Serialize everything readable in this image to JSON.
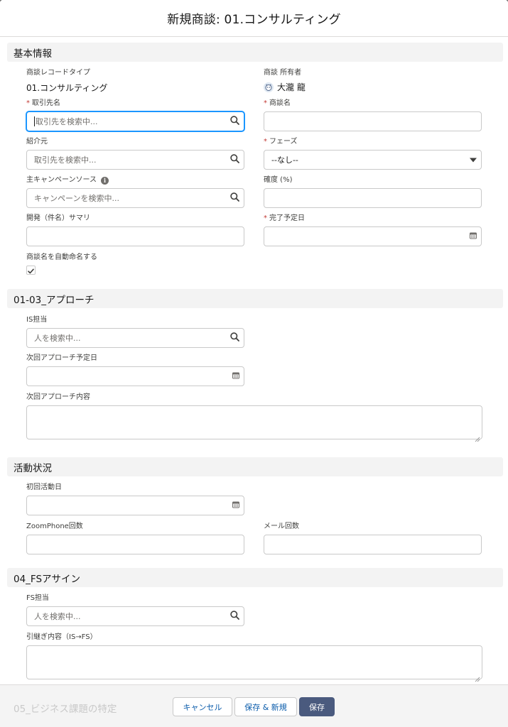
{
  "modal": {
    "title": "新規商談: 01.コンサルティング"
  },
  "sections": {
    "basic": "基本情報",
    "approach": "01-03_アプローチ",
    "activity": "活動状況",
    "fs": "04_FSアサイン",
    "business": "05_ビジネス課題の特定"
  },
  "fields": {
    "record_type": {
      "label": "商談レコードタイプ",
      "value": "01.コンサルティング"
    },
    "owner": {
      "label": "商談 所有者",
      "value": "大瀧 龍"
    },
    "account": {
      "label": "取引先名",
      "placeholder": "取引先を検索中..."
    },
    "opp_name": {
      "label": "商談名",
      "value": ""
    },
    "referrer": {
      "label": "紹介元",
      "placeholder": "取引先を検索中..."
    },
    "phase": {
      "label": "フェーズ",
      "value": "--なし--"
    },
    "campaign": {
      "label": "主キャンペーンソース",
      "placeholder": "キャンペーンを検索中..."
    },
    "probability": {
      "label": "確度 (%)",
      "value": ""
    },
    "summary": {
      "label": "開発（件名）サマリ",
      "value": ""
    },
    "close_date": {
      "label": "完了予定日",
      "value": ""
    },
    "auto_name": {
      "label": "商談名を自動命名する",
      "checked": true
    },
    "is_owner": {
      "label": "IS担当",
      "placeholder": "人を検索中..."
    },
    "next_date": {
      "label": "次回アプローチ予定日",
      "value": ""
    },
    "next_content": {
      "label": "次回アプローチ内容",
      "value": ""
    },
    "first_date": {
      "label": "初回活動日",
      "value": ""
    },
    "zoom_count": {
      "label": "ZoomPhone回数",
      "value": ""
    },
    "mail_count": {
      "label": "メール回数",
      "value": ""
    },
    "fs_owner": {
      "label": "FS担当",
      "placeholder": "人を検索中..."
    },
    "handover": {
      "label": "引継ぎ内容（IS→FS）",
      "value": ""
    }
  },
  "footer": {
    "cancel": "キャンセル",
    "save_new": "保存 & 新規",
    "save": "保存"
  },
  "icons": {
    "search": "search-icon",
    "calendar": "calendar-icon",
    "dropdown": "chevron-down-icon",
    "info": "info-icon",
    "check": "check-icon"
  },
  "colors": {
    "required": "#c23934",
    "focus": "#1b96ff",
    "brand": "#4a5a7e",
    "link": "#0b5cab"
  }
}
